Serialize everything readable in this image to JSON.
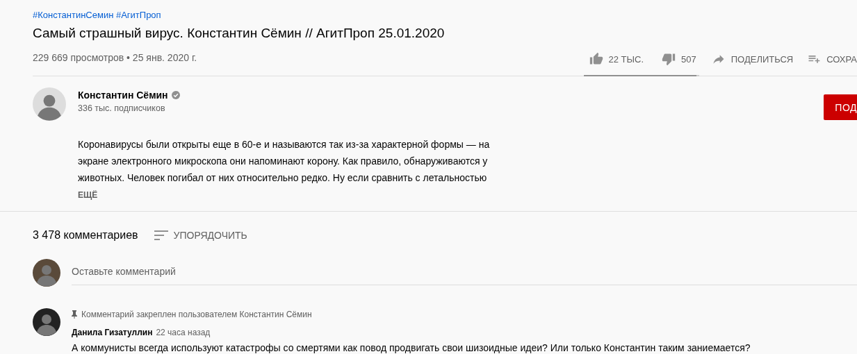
{
  "video": {
    "hashtags": "#КонстантинСемин #АгитПроп",
    "title": "Самый страшный вирус. Константин Сёмин // АгитПроп 25.01.2020",
    "meta": "229 669 просмотров • 25 янв. 2020 г.",
    "actions": [
      {
        "kind": "like",
        "label": "22 ТЫС."
      },
      {
        "kind": "dislike",
        "label": "507"
      },
      {
        "kind": "share",
        "label": "ПОДЕЛИТЬСЯ"
      },
      {
        "kind": "save",
        "label": "СОХРА"
      }
    ],
    "sentiment": {
      "level": 0.977
    }
  },
  "channel": {
    "name": "Константин Сёмин",
    "verified": true,
    "subscribers": "336 тыс. подписчиков",
    "subscribe_button": "ПОД"
  },
  "description": {
    "text": "Коронавирусы были открыты еще в 60-е и называются так из-за характерной формы — на экране электронного микроскопа они напоминают корону. Как правило, обнаруживаются у животных. Человек погибал от них относительно редко. Ну если сравнить с летальностью",
    "more": "ЕЩЁ"
  },
  "comments": {
    "count": "3 478 комментариев",
    "sort": "УПОРЯДОЧИТЬ",
    "input": {
      "placeholder": "Оставьте комментарий"
    },
    "items": [
      {
        "pinned_note": "Комментарий закреплен пользователем Константин Сёмин",
        "author": "Данила Гизатуллин",
        "time": "22 часа назад",
        "text": "А коммунисты всегда используют катастрофы со смертями как повод продвигать свои шизоидные идеи? Или только Константин таким заниемается?"
      }
    ]
  }
}
